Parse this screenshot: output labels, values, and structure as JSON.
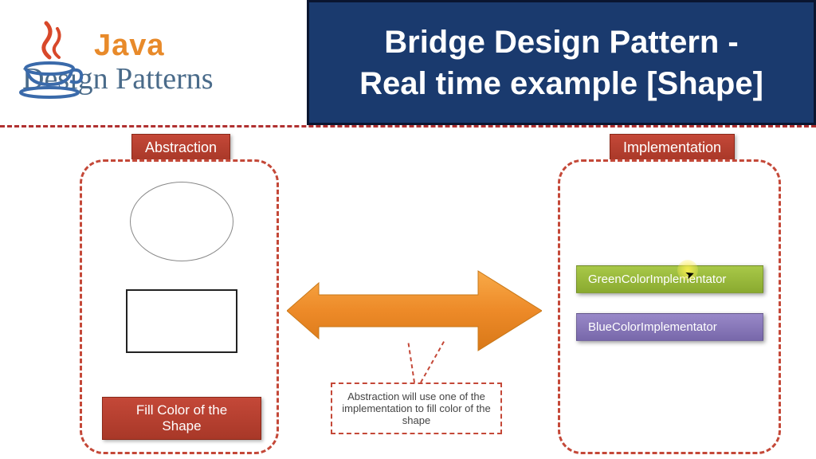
{
  "header": {
    "logo_line1": "Java",
    "logo_line2": "Design Patterns",
    "title_line1": "Bridge Design Pattern -",
    "title_line2": "Real time example [Shape]"
  },
  "diagram": {
    "abstraction_label": "Abstraction",
    "implementation_label": "Implementation",
    "fill_label": "Fill Color of the Shape",
    "green_impl": "GreenColorImplementator",
    "blue_impl": "BlueColorImplementator",
    "note": "Abstraction will use one of the implementation to fill color of the shape"
  },
  "colors": {
    "title_bg": "#1a3a6e",
    "label_bg": "#b83828",
    "dash": "#c44838",
    "arrow": "#ed8a28",
    "green": "#98b838",
    "purple": "#8878b8"
  }
}
